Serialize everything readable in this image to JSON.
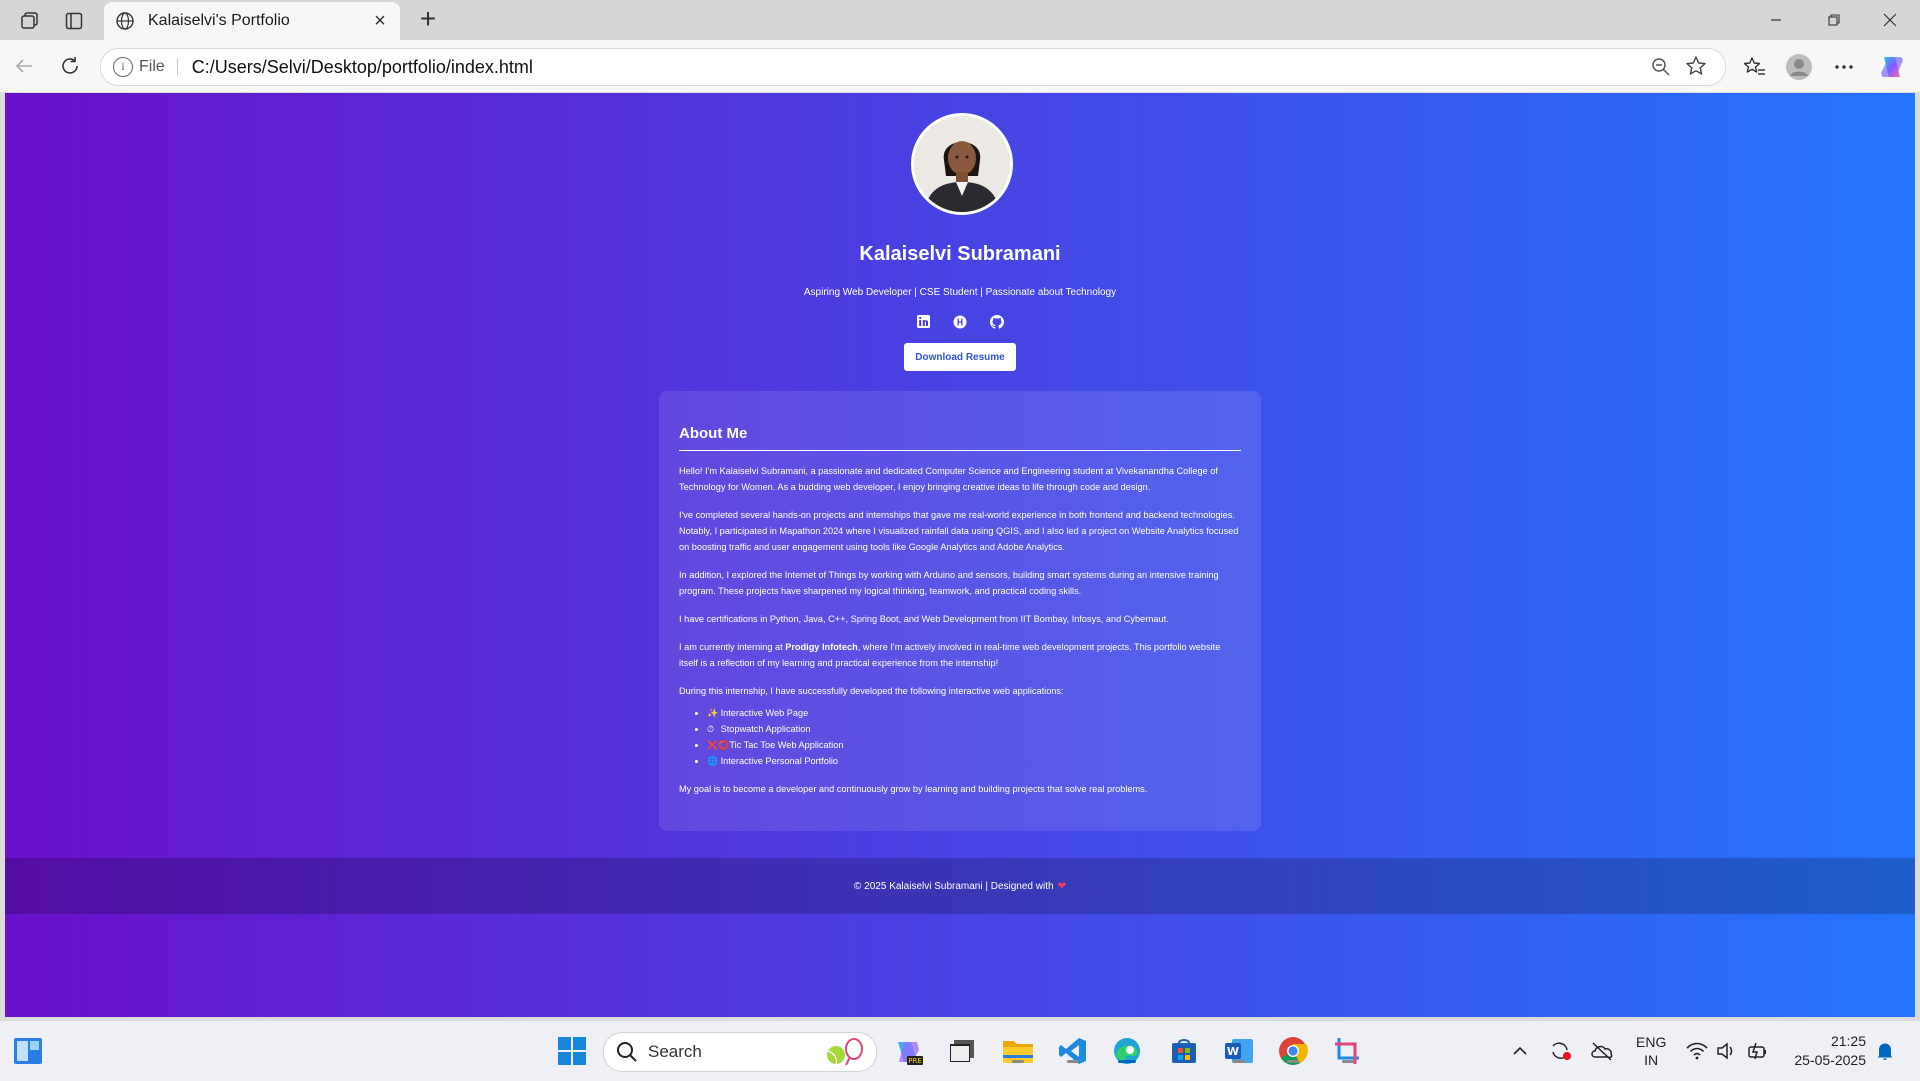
{
  "browser": {
    "tab_title": "Kalaiselvi's Portfolio",
    "new_tab": "+",
    "file_label": "File",
    "url": "C:/Users/Selvi/Desktop/portfolio/index.html"
  },
  "page": {
    "name": "Kalaiselvi Subramani",
    "tagline": "Aspiring Web Developer | CSE Student | Passionate about Technology",
    "resume_button": "Download Resume",
    "about": {
      "heading": "About Me",
      "p1": "Hello! I'm Kalaiselvi Subramani, a passionate and dedicated Computer Science and Engineering student at Vivekanandha College of Technology for Women. As a budding web developer, I enjoy bringing creative ideas to life through code and design.",
      "p2": "I've completed several hands-on projects and internships that gave me real-world experience in both frontend and backend technologies. Notably, I participated in Mapathon 2024 where I visualized rainfall data using QGIS, and I also led a project on Website Analytics focused on boosting traffic and user engagement using tools like Google Analytics and Adobe Analytics.",
      "p3": "In addition, I explored the Internet of Things by working with Arduino and sensors, building smart systems during an intensive training program. These projects have sharpened my logical thinking, teamwork, and practical coding skills.",
      "p4": "I have certifications in Python, Java, C++, Spring Boot, and Web Development from IIT Bombay, Infosys, and Cybernaut.",
      "p5_before": "I am currently interning at ",
      "p5_bold": "Prodigy Infotech",
      "p5_after": ", where I'm actively involved in real-time web development projects. This portfolio website itself is a reflection of my learning and practical experience from the internship!",
      "p6": "During this internship, I have successfully developed the following interactive web applications:",
      "projects": [
        {
          "emoji": "✨",
          "label": "Interactive Web Page"
        },
        {
          "emoji": "⏱",
          "label": "Stopwatch Application"
        },
        {
          "emoji": "❌⭕",
          "label": "Tic Tac Toe Web Application"
        },
        {
          "emoji": "🌐",
          "label": "Interactive Personal Portfolio"
        }
      ],
      "p7": "My goal is to become a developer and continuously grow by learning and building projects that solve real problems."
    },
    "footer": "© 2025 Kalaiselvi Subramani | Designed with",
    "footer_heart": "❤"
  },
  "taskbar": {
    "search_label": "Search",
    "lang_top": "ENG",
    "lang_bottom": "IN",
    "time": "21:25",
    "date": "25-05-2025"
  },
  "colors": {
    "gradient_start": "#6a11cb",
    "gradient_end": "#2575fc",
    "button_text": "#2f55d4"
  }
}
